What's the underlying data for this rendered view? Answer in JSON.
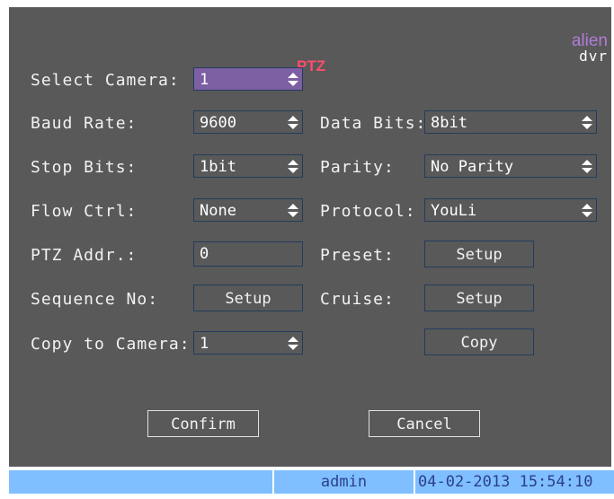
{
  "title": "PTZ",
  "logo": {
    "line1": "alien",
    "line2": "dvr"
  },
  "labels": {
    "select_camera": "Select Camera:",
    "baud_rate": "Baud Rate:",
    "data_bits": "Data Bits:",
    "stop_bits": "Stop Bits:",
    "parity": "Parity:",
    "flow_ctrl": "Flow Ctrl:",
    "protocol": "Protocol:",
    "ptz_addr": "PTZ Addr.:",
    "preset": "Preset:",
    "sequence_no": "Sequence No:",
    "cruise": "Cruise:",
    "copy_to_camera": "Copy to Camera:"
  },
  "values": {
    "select_camera": "1",
    "baud_rate": "9600",
    "data_bits": "8bit",
    "stop_bits": "1bit",
    "parity": "No Parity",
    "flow_ctrl": "None",
    "protocol": "YouLi",
    "ptz_addr": "0",
    "copy_to_camera": "1"
  },
  "buttons": {
    "preset_setup": "Setup",
    "sequence_setup": "Setup",
    "cruise_setup": "Setup",
    "copy": "Copy",
    "confirm": "Confirm",
    "cancel": "Cancel"
  },
  "status": {
    "user": "admin",
    "datetime": "04-02-2013 15:54:10"
  },
  "colors": {
    "panel": "#595959",
    "title": "#ff4d6a",
    "selected_field": "#7d5fa3",
    "status_bar": "#7fbfff"
  }
}
